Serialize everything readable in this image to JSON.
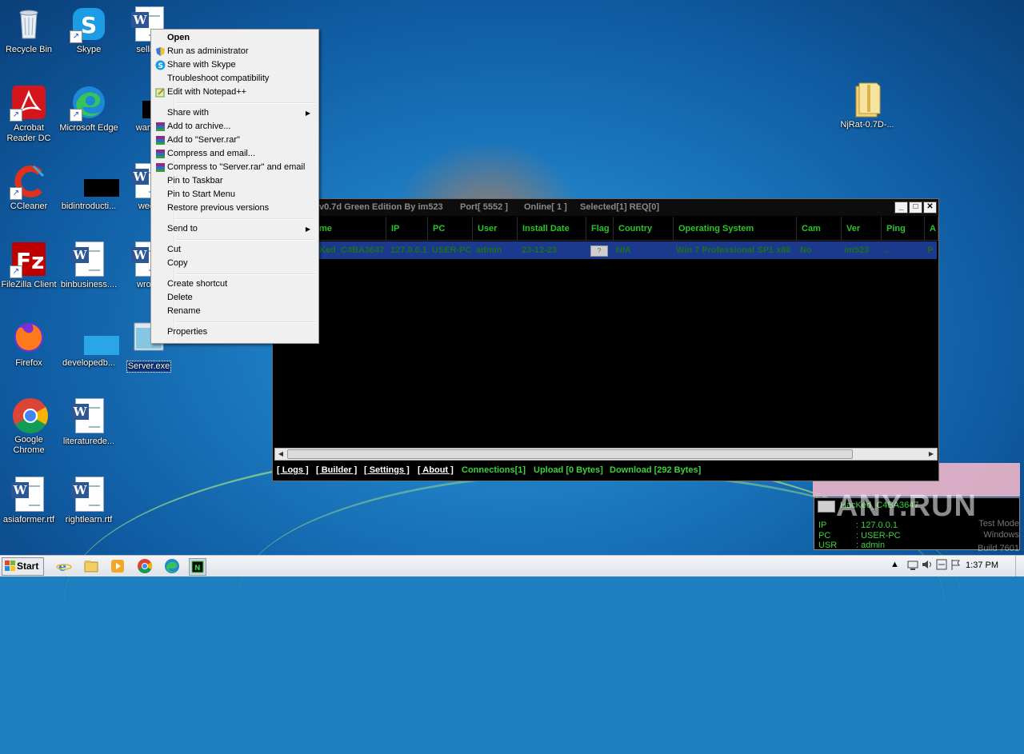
{
  "desktop": {
    "icons": [
      {
        "id": "recycle-bin",
        "label": "Recycle Bin"
      },
      {
        "id": "skype",
        "label": "Skype"
      },
      {
        "id": "sellings",
        "label": "selling"
      },
      {
        "id": "acrobat",
        "label": "Acrobat Reader DC"
      },
      {
        "id": "edge",
        "label": "Microsoft Edge"
      },
      {
        "id": "wantfor",
        "label": "wantfo"
      },
      {
        "id": "ccleaner",
        "label": "CCleaner"
      },
      {
        "id": "bidintroduction",
        "label": "bidintroducti..."
      },
      {
        "id": "wedge",
        "label": "wedg"
      },
      {
        "id": "filezilla",
        "label": "FileZilla Client"
      },
      {
        "id": "binbusiness",
        "label": "binbusiness...."
      },
      {
        "id": "wrong",
        "label": "wrong"
      },
      {
        "id": "firefox",
        "label": "Firefox"
      },
      {
        "id": "developedb",
        "label": "developedb..."
      },
      {
        "id": "server",
        "label": "Server.exe"
      },
      {
        "id": "chrome",
        "label": "Google Chrome"
      },
      {
        "id": "literature",
        "label": "literaturede..."
      },
      {
        "id": "asiaformer",
        "label": "asiaformer.rtf"
      },
      {
        "id": "rightlearn",
        "label": "rightlearn.rtf"
      },
      {
        "id": "njrat-folder",
        "label": "NjRat-0.7D-..."
      }
    ]
  },
  "context_menu": {
    "items": [
      {
        "label": "Open",
        "bold": true
      },
      {
        "label": "Run as administrator",
        "icon": "shield-icon"
      },
      {
        "label": "Share with Skype",
        "icon": "skype-icon"
      },
      {
        "label": "Troubleshoot compatibility"
      },
      {
        "label": "Edit with Notepad++",
        "icon": "notepadpp-icon"
      },
      {
        "label": "Share with",
        "submenu": true
      },
      {
        "label": "Add to archive...",
        "icon": "winrar-icon"
      },
      {
        "label": "Add to \"Server.rar\"",
        "icon": "winrar-icon"
      },
      {
        "label": "Compress and email...",
        "icon": "winrar-icon"
      },
      {
        "label": "Compress to \"Server.rar\" and email",
        "icon": "winrar-icon"
      },
      {
        "label": "Pin to Taskbar"
      },
      {
        "label": "Pin to Start Menu"
      },
      {
        "label": "Restore previous versions"
      },
      {
        "label": "Send to",
        "submenu": true
      },
      {
        "label": "Cut"
      },
      {
        "label": "Copy"
      },
      {
        "label": "Create shortcut"
      },
      {
        "label": "Delete"
      },
      {
        "label": "Rename"
      },
      {
        "label": "Properties"
      }
    ]
  },
  "rat_window": {
    "title_left": "v0.7d Green Edition By im523",
    "title_port": "Port[ 5552 ]",
    "title_online": "Online[ 1 ]",
    "title_selected": "Selected[1] REQ[0]",
    "columns": [
      "me",
      "IP",
      "PC",
      "User",
      "Install Date",
      "Flag",
      "Country",
      "Operating System",
      "Cam",
      "Ver",
      "Ping",
      "A"
    ],
    "row": {
      "name": "Ked_C4BA3647",
      "ip": "127.0.0.1",
      "pc": "USER-PC",
      "user": "admin",
      "install_date": "23-12-23",
      "flag": "?",
      "country": "N/A",
      "os": "Win 7 Professional SP1 x86",
      "cam": "No",
      "ver": "im523",
      "ping": "..",
      "a": "P"
    },
    "status": {
      "logs": "[ Logs ]",
      "builder": "[ Builder ]",
      "settings": "[ Settings ]",
      "about": "[ About ]",
      "connections": "Connections[1]",
      "upload": "Upload [0 Bytes]",
      "download": "Download [292 Bytes]"
    },
    "colors": {
      "accent": "#27c627",
      "row_bg": "#1b3a8e"
    }
  },
  "notification": {
    "name": "HacKed_C4BA3647",
    "ip_label": "IP",
    "ip_value": ": 127.0.0.1",
    "pc_label": "PC",
    "pc_value": ": USER-PC",
    "usr_label": "USR",
    "usr_value": ": admin"
  },
  "watermark": {
    "text": "ANY.RUN",
    "test_mode": "Test Mode",
    "windows": "Windows",
    "build": "Build 7601"
  },
  "taskbar": {
    "start_label": "Start",
    "pinned": [
      "ie-icon",
      "explorer-icon",
      "media-player-icon",
      "chrome-icon",
      "edge-icon",
      "njrat-icon"
    ],
    "clock": "1:37 PM"
  }
}
